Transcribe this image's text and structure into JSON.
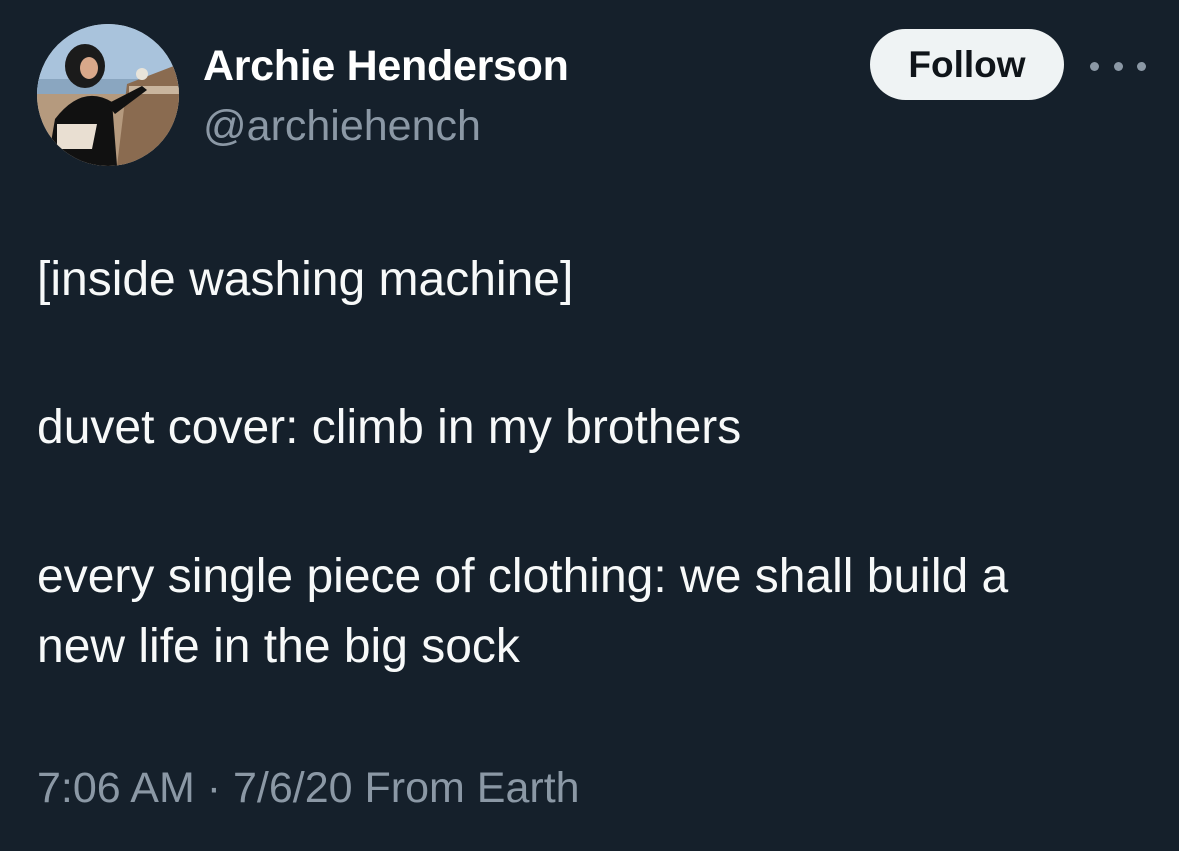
{
  "author": {
    "name": "Archie Henderson",
    "handle": "@archiehench",
    "avatar_icon": "profile-photo"
  },
  "actions": {
    "follow_label": "Follow",
    "more_icon": "more-options-icon"
  },
  "tweet": {
    "lines": [
      "[inside washing machine]",
      "duvet cover: climb in my brothers",
      "every single piece of clothing: we shall build a",
      "new life in the big sock"
    ]
  },
  "meta": {
    "time": "7:06 AM",
    "separator": "·",
    "date": "7/6/20",
    "source": "From Earth"
  },
  "colors": {
    "background": "#15202b",
    "text": "#f7f9f9",
    "secondary_text": "#8b98a5",
    "follow_bg": "#eff3f4",
    "follow_text": "#0f1419"
  }
}
